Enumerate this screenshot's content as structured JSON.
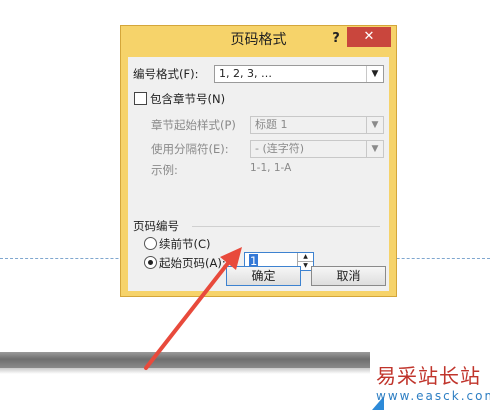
{
  "dialog": {
    "title": "页码格式",
    "help_label": "?",
    "close_label": "✕",
    "number_format": {
      "label": "编号格式(F):",
      "value": "1, 2, 3, …"
    },
    "include_chapter": {
      "label": "包含章节号(N)",
      "checked": false
    },
    "chapter_style": {
      "label": "章节起始样式(P)",
      "value": "标题 1"
    },
    "separator": {
      "label": "使用分隔符(E):",
      "value": "-  (连字符)"
    },
    "example": {
      "label": "示例:",
      "value": "1-1, 1-A"
    },
    "page_numbering": {
      "section_label": "页码编号",
      "continue_option": "续前节(C)",
      "start_option": "起始页码(A):",
      "selected": "start",
      "start_value": "1"
    },
    "ok_label": "确定",
    "cancel_label": "取消"
  },
  "watermark": {
    "text": "易采站长站",
    "url": "www.easck.com"
  },
  "colors": {
    "dialog_frame": "#f6d36a",
    "close_button": "#c9463d",
    "annotation_arrow": "#e84a3c"
  }
}
